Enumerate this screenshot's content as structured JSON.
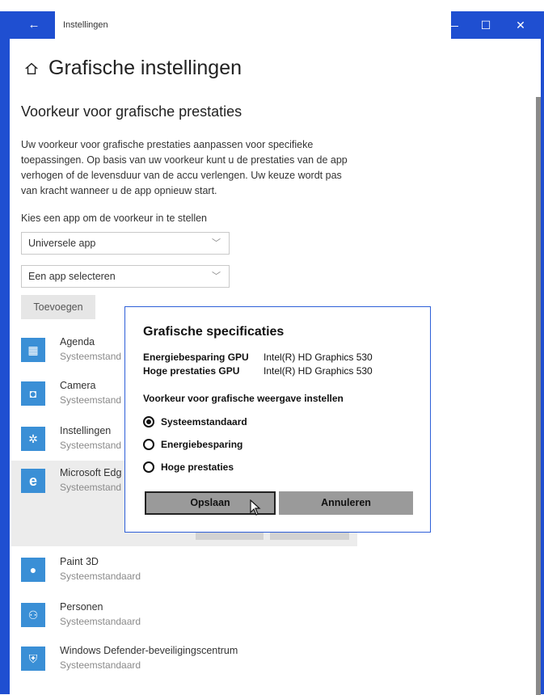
{
  "window": {
    "tab_title": "Instellingen",
    "back_glyph": "←",
    "minimize_glyph": "—",
    "maximize_glyph": "☐",
    "close_glyph": "✕",
    "accent_color": "#1f4fd1"
  },
  "page": {
    "title": "Grafische instellingen",
    "home_icon": "home-icon"
  },
  "section": {
    "title": "Voorkeur voor grafische prestaties",
    "description": "Uw voorkeur voor grafische prestaties aanpassen voor specifieke toepassingen. Op basis van uw voorkeur kunt u de prestaties van de app verhogen of de levensduur van de accu verlengen. Uw keuze wordt pas van kracht wanneer u de app opnieuw start.",
    "pick_label": "Kies een app om de voorkeur in te stellen",
    "app_type_dropdown": "Universele app",
    "app_select_dropdown": "Een app selecteren",
    "add_button": "Toevoegen"
  },
  "apps": [
    {
      "name": "Agenda",
      "sub": "Systeemstand",
      "icon": "calendar-icon",
      "color": "#3a8fd6"
    },
    {
      "name": "Camera",
      "sub": "Systeemstand",
      "icon": "camera-icon",
      "color": "#3a8fd6"
    },
    {
      "name": "Instellingen",
      "sub": "Systeemstand",
      "icon": "gear-icon",
      "color": "#3a8fd6"
    },
    {
      "name": "Microsoft Edg",
      "sub": "Systeemstand",
      "icon": "edge-icon",
      "color": "#3a8fd6"
    },
    {
      "name": "Paint 3D",
      "sub": "Systeemstandaard",
      "icon": "paint3d-icon",
      "color": "#3a8fd6"
    },
    {
      "name": "Personen",
      "sub": "Systeemstandaard",
      "icon": "people-icon",
      "color": "#3a8fd6"
    },
    {
      "name": "Windows Defender-beveiligingscentrum",
      "sub": "Systeemstandaard",
      "icon": "shield-icon",
      "color": "#3a8fd6"
    }
  ],
  "dialog": {
    "title": "Grafische specificaties",
    "specs": [
      {
        "label": "Energiebesparing GPU",
        "value": "Intel(R) HD Graphics 530"
      },
      {
        "label": "Hoge prestaties GPU",
        "value": "Intel(R) HD Graphics 530"
      }
    ],
    "preference_label": "Voorkeur voor grafische weergave instellen",
    "options": [
      {
        "label": "Systeemstandaard",
        "selected": true
      },
      {
        "label": "Energiebesparing",
        "selected": false
      },
      {
        "label": "Hoge prestaties",
        "selected": false
      }
    ],
    "save_button": "Opslaan",
    "cancel_button": "Annuleren"
  }
}
